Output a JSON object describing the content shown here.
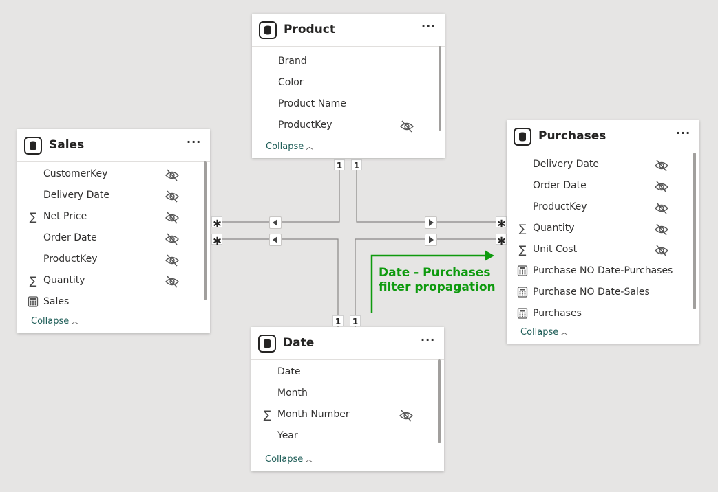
{
  "tables": {
    "product": {
      "title": "Product",
      "more_label": "···",
      "fields": [
        {
          "type_icon": "",
          "name": "Brand",
          "hidden": false
        },
        {
          "type_icon": "",
          "name": "Color",
          "hidden": false
        },
        {
          "type_icon": "",
          "name": "Product Name",
          "hidden": false
        },
        {
          "type_icon": "",
          "name": "ProductKey",
          "hidden": true
        }
      ],
      "collapse_label": "Collapse"
    },
    "sales": {
      "title": "Sales",
      "more_label": "···",
      "fields": [
        {
          "type_icon": "",
          "name": "CustomerKey",
          "hidden": true
        },
        {
          "type_icon": "",
          "name": "Delivery Date",
          "hidden": true
        },
        {
          "type_icon": "sigma-icon",
          "name": "Net Price",
          "hidden": true
        },
        {
          "type_icon": "",
          "name": "Order Date",
          "hidden": true
        },
        {
          "type_icon": "",
          "name": "ProductKey",
          "hidden": true
        },
        {
          "type_icon": "sigma-icon",
          "name": "Quantity",
          "hidden": true
        },
        {
          "type_icon": "calculator-icon",
          "name": "Sales",
          "hidden": false
        }
      ],
      "collapse_label": "Collapse"
    },
    "purchases": {
      "title": "Purchases",
      "more_label": "···",
      "fields": [
        {
          "type_icon": "",
          "name": "Delivery Date",
          "hidden": true
        },
        {
          "type_icon": "",
          "name": "Order Date",
          "hidden": true
        },
        {
          "type_icon": "",
          "name": "ProductKey",
          "hidden": true
        },
        {
          "type_icon": "sigma-icon",
          "name": "Quantity",
          "hidden": true
        },
        {
          "type_icon": "sigma-icon",
          "name": "Unit Cost",
          "hidden": true
        },
        {
          "type_icon": "calculator-icon",
          "name": "Purchase NO Date-Purchases",
          "hidden": false
        },
        {
          "type_icon": "calculator-icon",
          "name": "Purchase NO Date-Sales",
          "hidden": false
        },
        {
          "type_icon": "calculator-icon",
          "name": "Purchases",
          "hidden": false
        }
      ],
      "collapse_label": "Collapse"
    },
    "date": {
      "title": "Date",
      "more_label": "···",
      "fields": [
        {
          "type_icon": "",
          "name": "Date",
          "hidden": false
        },
        {
          "type_icon": "",
          "name": "Month",
          "hidden": false
        },
        {
          "type_icon": "sigma-icon",
          "name": "Month Number",
          "hidden": true
        },
        {
          "type_icon": "",
          "name": "Year",
          "hidden": false
        }
      ],
      "collapse_label": "Collapse"
    }
  },
  "relationships": {
    "product_sales_one": "1",
    "product_purchases_one": "1",
    "date_sales_one": "1",
    "date_purchases_one": "1",
    "sales_product_many": "∗",
    "sales_date_many": "∗",
    "purchases_product_many": "∗",
    "purchases_date_many": "∗"
  },
  "annotation": {
    "line1": "Date - Purchases",
    "line2": "filter propagation"
  },
  "colors": {
    "canvas": "#e6e5e4",
    "line": "#8a8886",
    "annotation": "#0e9a0e",
    "link": "#1f5e58"
  }
}
